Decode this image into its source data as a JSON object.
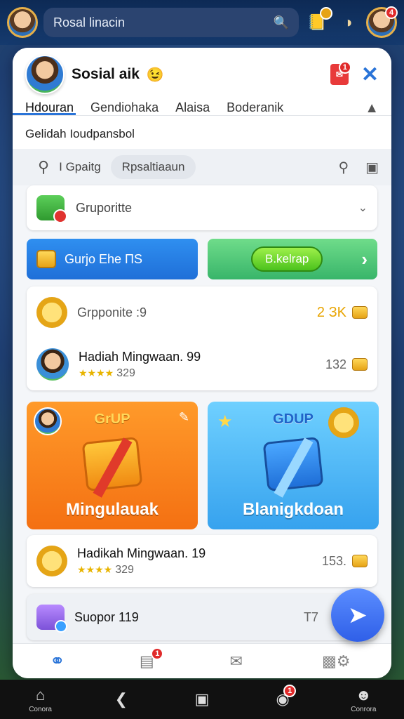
{
  "topbar": {
    "search_text": "Rosal linacin",
    "badge_left": "",
    "badge_right": "4"
  },
  "panel": {
    "title": "Sosial aik",
    "title_emoji": "😉",
    "pdf_badge": "1",
    "tabs": [
      "Hdouran",
      "Gendiohaka",
      "Alaisa",
      "Boderanik"
    ],
    "section_title": "Gelidah Ioudpansbol",
    "toolbar": {
      "filter_label": "I Gpaitg",
      "pill_label": "Rpsaltiaaun"
    },
    "group_card": {
      "label": "Gruporitte"
    },
    "buttons": {
      "blue_label": "Gurjo Ehe ПS",
      "green_label": "B.kelrap"
    },
    "list": [
      {
        "title": "Grpponite :9",
        "value": "2 ЗK",
        "stars": "",
        "rating": ""
      },
      {
        "title": "Hadiah Mingwaan. 99",
        "value": "132",
        "stars": "★★★★",
        "rating": "329"
      }
    ],
    "tiles": [
      {
        "top": "GrUP",
        "bottom": "Mingulauak"
      },
      {
        "top": "GDUP",
        "bottom": "Blanigkdoan"
      }
    ],
    "reward": {
      "title": "Hadikah Mingwaan. 19",
      "value": "153.",
      "stars": "★★★★",
      "rating": "329"
    },
    "support": {
      "title": "Suopor 119",
      "value": "T7"
    },
    "nav_badge": "1"
  },
  "system_nav": {
    "items": [
      "Conora",
      "",
      "",
      "",
      "Conrora"
    ],
    "badge": "1"
  },
  "colors": {
    "accent": "#2a74d8",
    "orange_tile": "#f47012",
    "blue_tile": "#36a2ee",
    "badge": "#e02b2b"
  }
}
